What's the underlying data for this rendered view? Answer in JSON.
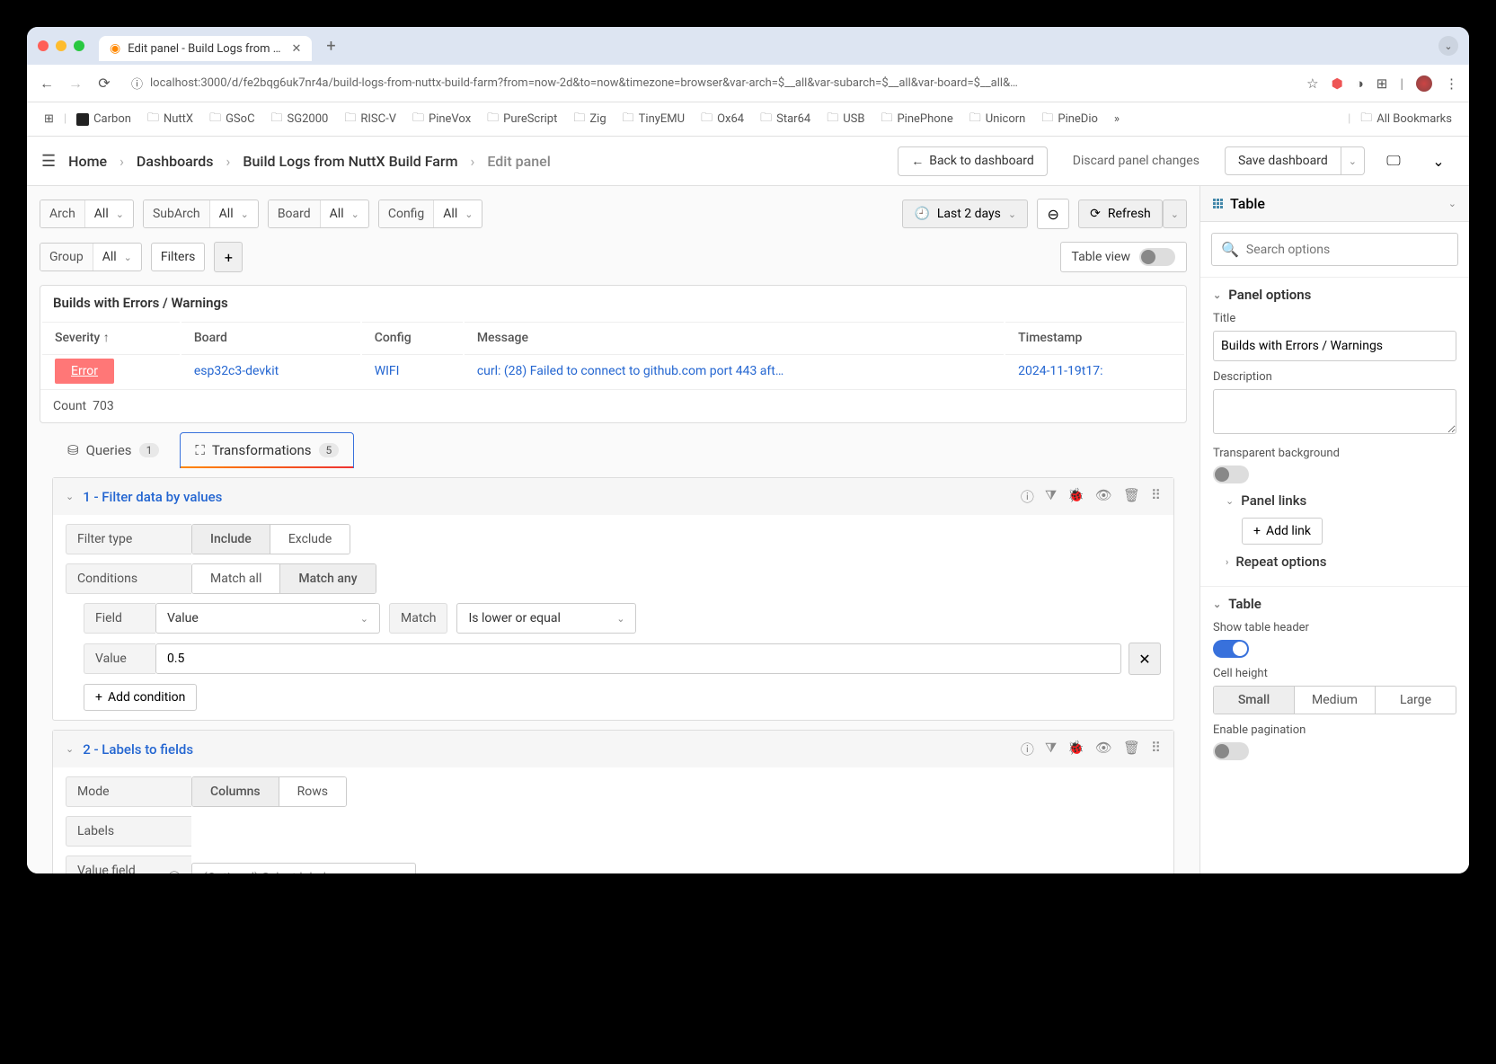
{
  "browser": {
    "tab_title": "Edit panel - Build Logs from …",
    "url": "localhost:3000/d/fe2bqg6uk7nr4a/build-logs-from-nuttx-build-farm?from=now-2d&to=now&timezone=browser&var-arch=$__all&var-subarch=$__all&var-board=$__all&…",
    "bookmarks": [
      "Carbon",
      "NuttX",
      "GSoC",
      "SG2000",
      "RISC-V",
      "PineVox",
      "PureScript",
      "Zig",
      "TinyEMU",
      "Ox64",
      "Star64",
      "USB",
      "PinePhone",
      "Unicorn",
      "PineDio"
    ],
    "all_bookmarks": "All Bookmarks"
  },
  "header": {
    "crumbs": [
      "Home",
      "Dashboards",
      "Build Logs from NuttX Build Farm",
      "Edit panel"
    ],
    "back": "Back to dashboard",
    "discard": "Discard panel changes",
    "save": "Save dashboard"
  },
  "vars": [
    {
      "label": "Arch",
      "value": "All"
    },
    {
      "label": "SubArch",
      "value": "All"
    },
    {
      "label": "Board",
      "value": "All"
    },
    {
      "label": "Config",
      "value": "All"
    },
    {
      "label": "Group",
      "value": "All"
    }
  ],
  "filters_label": "Filters",
  "timerange": "Last 2 days",
  "refresh": "Refresh",
  "table_view": "Table view",
  "panel": {
    "title": "Builds with Errors / Warnings",
    "columns": [
      "Severity",
      "Board",
      "Config",
      "Message",
      "Timestamp"
    ],
    "sort_col": "Severity",
    "row": {
      "severity": "Error",
      "board": "esp32c3-devkit",
      "config": "WIFI",
      "message": "curl: (28) Failed to connect to github.com port 443 aft…",
      "timestamp": "2024-11-19t17:"
    },
    "count_label": "Count",
    "count": "703"
  },
  "tabs": {
    "queries": "Queries",
    "queries_badge": "1",
    "transforms": "Transformations",
    "transforms_badge": "5"
  },
  "xform1": {
    "title": "1 - Filter data by values",
    "filter_type": "Filter type",
    "include": "Include",
    "exclude": "Exclude",
    "conditions": "Conditions",
    "match_all": "Match all",
    "match_any": "Match any",
    "field": "Field",
    "field_val": "Value",
    "match": "Match",
    "match_val": "Is lower or equal",
    "value": "Value",
    "value_val": "0.5",
    "add_condition": "Add condition"
  },
  "xform2": {
    "title": "2 - Labels to fields",
    "mode": "Mode",
    "columns": "Columns",
    "rows": "Rows",
    "labels": "Labels",
    "vfn": "Value field name",
    "vfn_ph": "(Optional) Select label"
  },
  "side": {
    "viz": "Table",
    "search_ph": "Search options",
    "panel_options": "Panel options",
    "title_lbl": "Title",
    "desc_lbl": "Description",
    "transparent": "Transparent background",
    "panel_links": "Panel links",
    "add_link": "Add link",
    "repeat": "Repeat options",
    "table": "Table",
    "show_header": "Show table header",
    "cell_height": "Cell height",
    "cell_opts": [
      "Small",
      "Medium",
      "Large"
    ],
    "pagination": "Enable pagination"
  }
}
